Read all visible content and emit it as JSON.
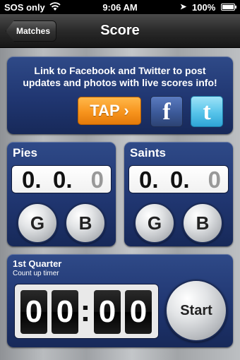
{
  "status_bar": {
    "carrier": "SOS only",
    "time": "9:06 AM",
    "battery": "100%"
  },
  "nav": {
    "back_label": "Matches",
    "title": "Score"
  },
  "social": {
    "text": "Link to Facebook and Twitter to post updates and photos with live scores info!",
    "tap_label": "TAP ›",
    "facebook_glyph": "f",
    "twitter_glyph": "t"
  },
  "teams": [
    {
      "name": "Pies",
      "goals": "0.",
      "behinds": "0.",
      "total": "0",
      "goal_label": "G",
      "behind_label": "B"
    },
    {
      "name": "Saints",
      "goals": "0.",
      "behinds": "0.",
      "total": "0",
      "goal_label": "G",
      "behind_label": "B"
    }
  ],
  "timer": {
    "title": "1st Quarter",
    "subtitle": "Count up timer",
    "digits": [
      "0",
      "0",
      "0",
      "0"
    ],
    "separator": ":",
    "start_label": "Start"
  },
  "colors": {
    "panel": "#203671",
    "tap_orange": "#f7941d",
    "facebook_blue": "#3b5998",
    "twitter_blue": "#56c3ea"
  }
}
